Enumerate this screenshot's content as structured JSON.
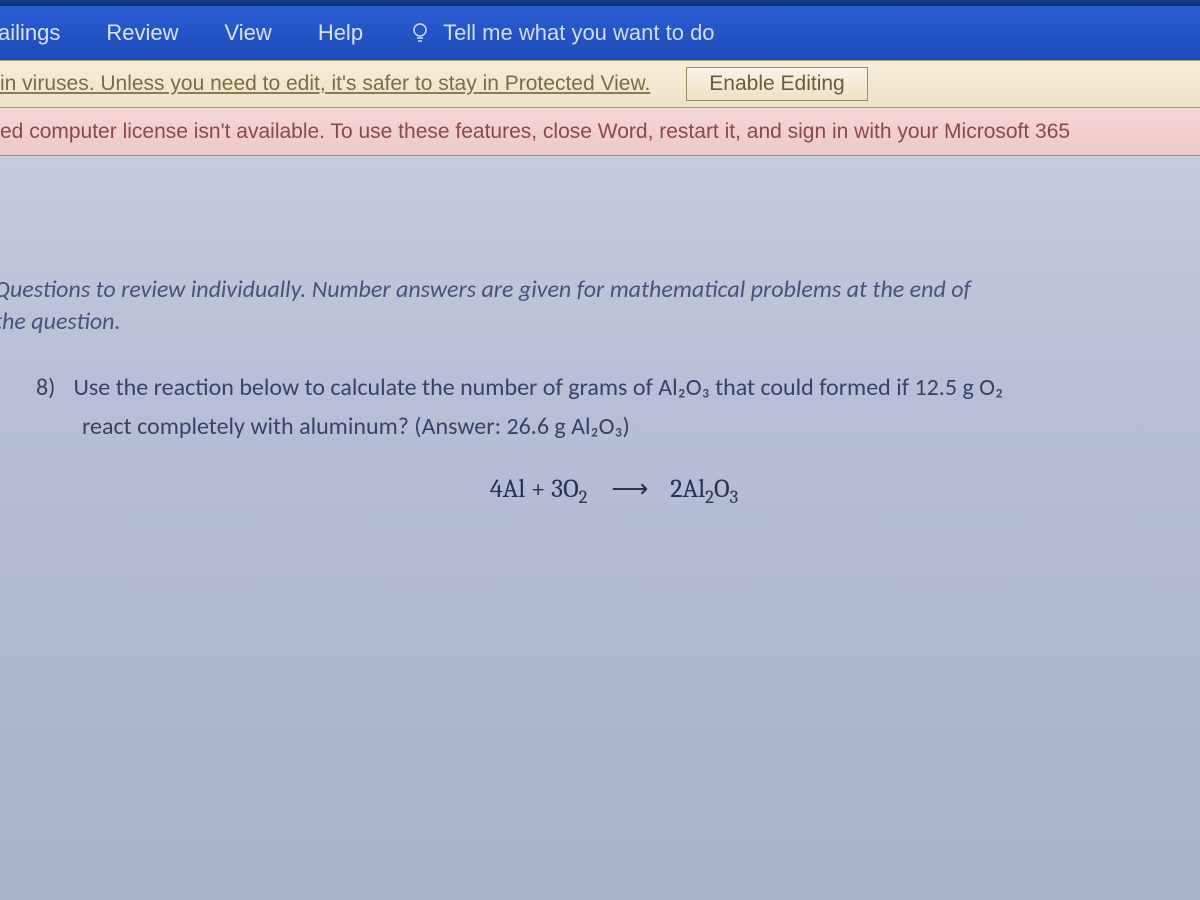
{
  "ribbon": {
    "tabs": [
      "ailings",
      "Review",
      "View",
      "Help"
    ],
    "tellMe": "Tell me what you want to do"
  },
  "protectedView": {
    "message": "in viruses. Unless you need to edit, it's safer to stay in Protected View.",
    "button": "Enable Editing"
  },
  "licenseBar": {
    "message": "ed computer license isn't available. To use these features, close Word, restart it, and sign in with your Microsoft 365"
  },
  "document": {
    "introLine1": "Questions to review individually.  Number answers are given for mathematical problems at the end of",
    "introLine2": "the question.",
    "question": {
      "number": "8)",
      "line1": "Use the reaction below to calculate the number of grams of Al₂O₃ that could formed if 12.5 g O₂",
      "line2": "react completely with aluminum? (Answer: 26.6 g Al₂O₃)",
      "equationLeft": "4Al  +  3O",
      "equationLeftSub": "2",
      "arrow": "⟶",
      "equationRight": "2Al",
      "equationRightSub1": "2",
      "equationRightMid": "O",
      "equationRightSub2": "3"
    }
  }
}
